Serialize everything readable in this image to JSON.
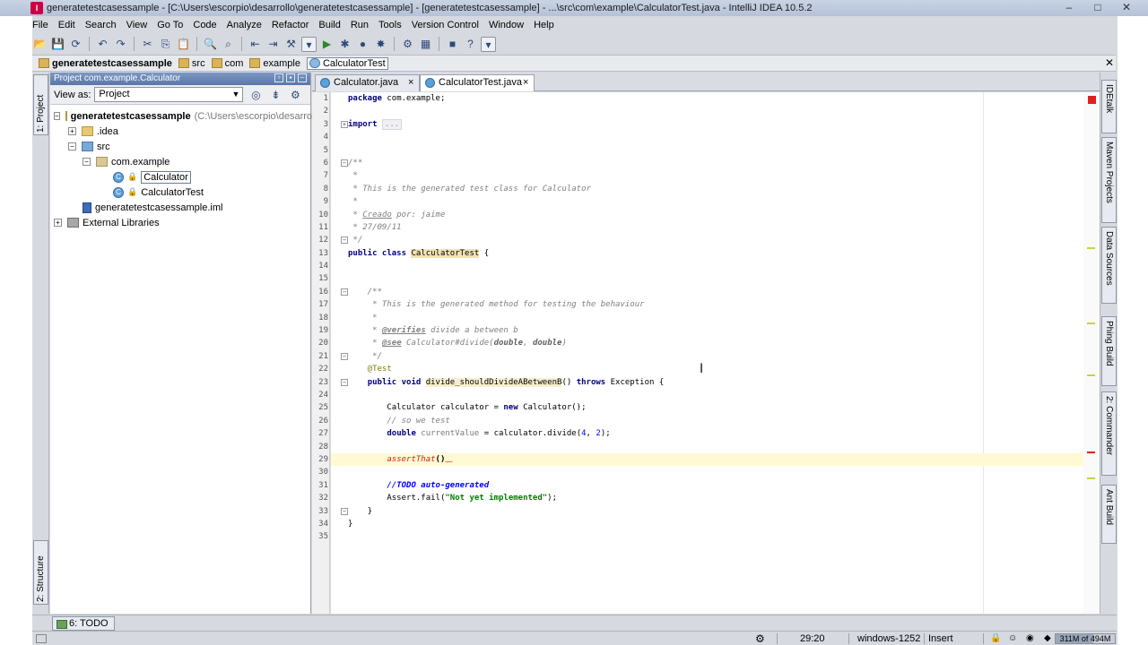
{
  "window": {
    "title": "generatetestcasessample - [C:\\Users\\escorpio\\desarrollo\\generatetestcasessample] - [generatetestcasessample] - ...\\src\\com\\example\\CalculatorTest.java - IntelliJ IDEA 10.5.2",
    "minimize": "–",
    "maximize": "□",
    "close": "✕"
  },
  "menu": [
    "File",
    "Edit",
    "Search",
    "View",
    "Go To",
    "Code",
    "Analyze",
    "Refactor",
    "Build",
    "Run",
    "Tools",
    "Version Control",
    "Window",
    "Help"
  ],
  "navbar": {
    "crumbs": [
      "generatetestcasessample",
      "src",
      "com",
      "example",
      "CalculatorTest"
    ],
    "close": "✕"
  },
  "left_tabs": {
    "project": "1: Project",
    "structure": "2: Structure"
  },
  "project_panel": {
    "header": "Project com.example.Calculator",
    "view_as_label": "View as:",
    "view_as_value": "Project",
    "tree": [
      {
        "label": "generatetestcasessample",
        "sub": "(C:\\Users\\escorpio\\desarrollo\\",
        "toggle": "−"
      },
      {
        "label": ".idea",
        "toggle": "+"
      },
      {
        "label": "src",
        "toggle": "−"
      },
      {
        "label": "com.example",
        "toggle": "−"
      },
      {
        "label": "Calculator"
      },
      {
        "label": "CalculatorTest"
      },
      {
        "label": "generatetestcasessample.iml"
      },
      {
        "label": "External Libraries",
        "toggle": "+"
      }
    ]
  },
  "editor": {
    "tabs": [
      {
        "label": "Calculator.java",
        "close": "×"
      },
      {
        "label": "CalculatorTest.java",
        "close": "×"
      }
    ],
    "line_numbers": [
      "1",
      "2",
      "3",
      "4",
      "5",
      "6",
      "7",
      "8",
      "9",
      "10",
      "11",
      "12",
      "13",
      "14",
      "15",
      "16",
      "17",
      "18",
      "19",
      "20",
      "21",
      "22",
      "23",
      "24",
      "25",
      "26",
      "27",
      "28",
      "29",
      "30",
      "31",
      "32",
      "33",
      "34",
      "35"
    ],
    "code": {
      "l1_kw": "package",
      "l1_rest": " com.example;",
      "l3_kw": "import",
      "l3_ellipsis": "...",
      "l6": "/**",
      "l7": " *",
      "l8": " * This is the generated test class for Calculator",
      "l9": " *",
      "l10_a": " * ",
      "l10_b": "Creado",
      "l10_c": " por: jaime",
      "l11": " * 27/09/11",
      "l12": " */",
      "l13_kw": "public class",
      "l13_sp": " ",
      "l13_name": "CalculatorTest",
      "l13_rest": " {",
      "l16": "    /**",
      "l17": "     * This is the generated method for testing the behaviour",
      "l18": "     *",
      "l19_a": "     * ",
      "l19_tag": "@verifies",
      "l19_b": " divide a between b",
      "l20_a": "     * ",
      "l20_tag": "@see",
      "l20_b": " Calculator#divide(",
      "l20_c": "double",
      "l20_d": ", ",
      "l20_e": "double",
      "l20_f": ")",
      "l21": "     */",
      "l22": "    @Test",
      "l23_a": "    ",
      "l23_kw": "public void",
      "l23_sp": " ",
      "l23_name": "divide_shouldDivideABetweenB",
      "l23_b": "() ",
      "l23_kw2": "throws",
      "l23_c": " Exception {",
      "l25_a": "        Calculator calculator = ",
      "l25_kw": "new",
      "l25_b": " Calculator();",
      "l26": "        // so we test",
      "l27_a": "        ",
      "l27_kw": "double",
      "l27_sp": " ",
      "l27_var": "currentValue",
      "l27_b": " = calculator.divide(",
      "l27_n1": "4",
      "l27_c": ", ",
      "l27_n2": "2",
      "l27_d": ");",
      "l29_a": "        ",
      "l29_call": "assertThat",
      "l29_b": "()",
      "l31_a": "        ",
      "l31_todo": "//TODO auto-generated",
      "l32_a": "        Assert.fail(",
      "l32_str": "\"Not yet implemented\"",
      "l32_b": ");",
      "l33": "    }",
      "l34": "}"
    }
  },
  "right_tabs": [
    "IDEtalk",
    "Maven Projects",
    "Data Sources",
    "Phing Build",
    "2: Commander",
    "Ant Build"
  ],
  "bottom": {
    "todo": "6: TODO"
  },
  "status": {
    "position": "29:20",
    "encoding": "windows-1252",
    "mode": "Insert",
    "memory": "311M of 494M",
    "memory_fraction": 0.63
  }
}
